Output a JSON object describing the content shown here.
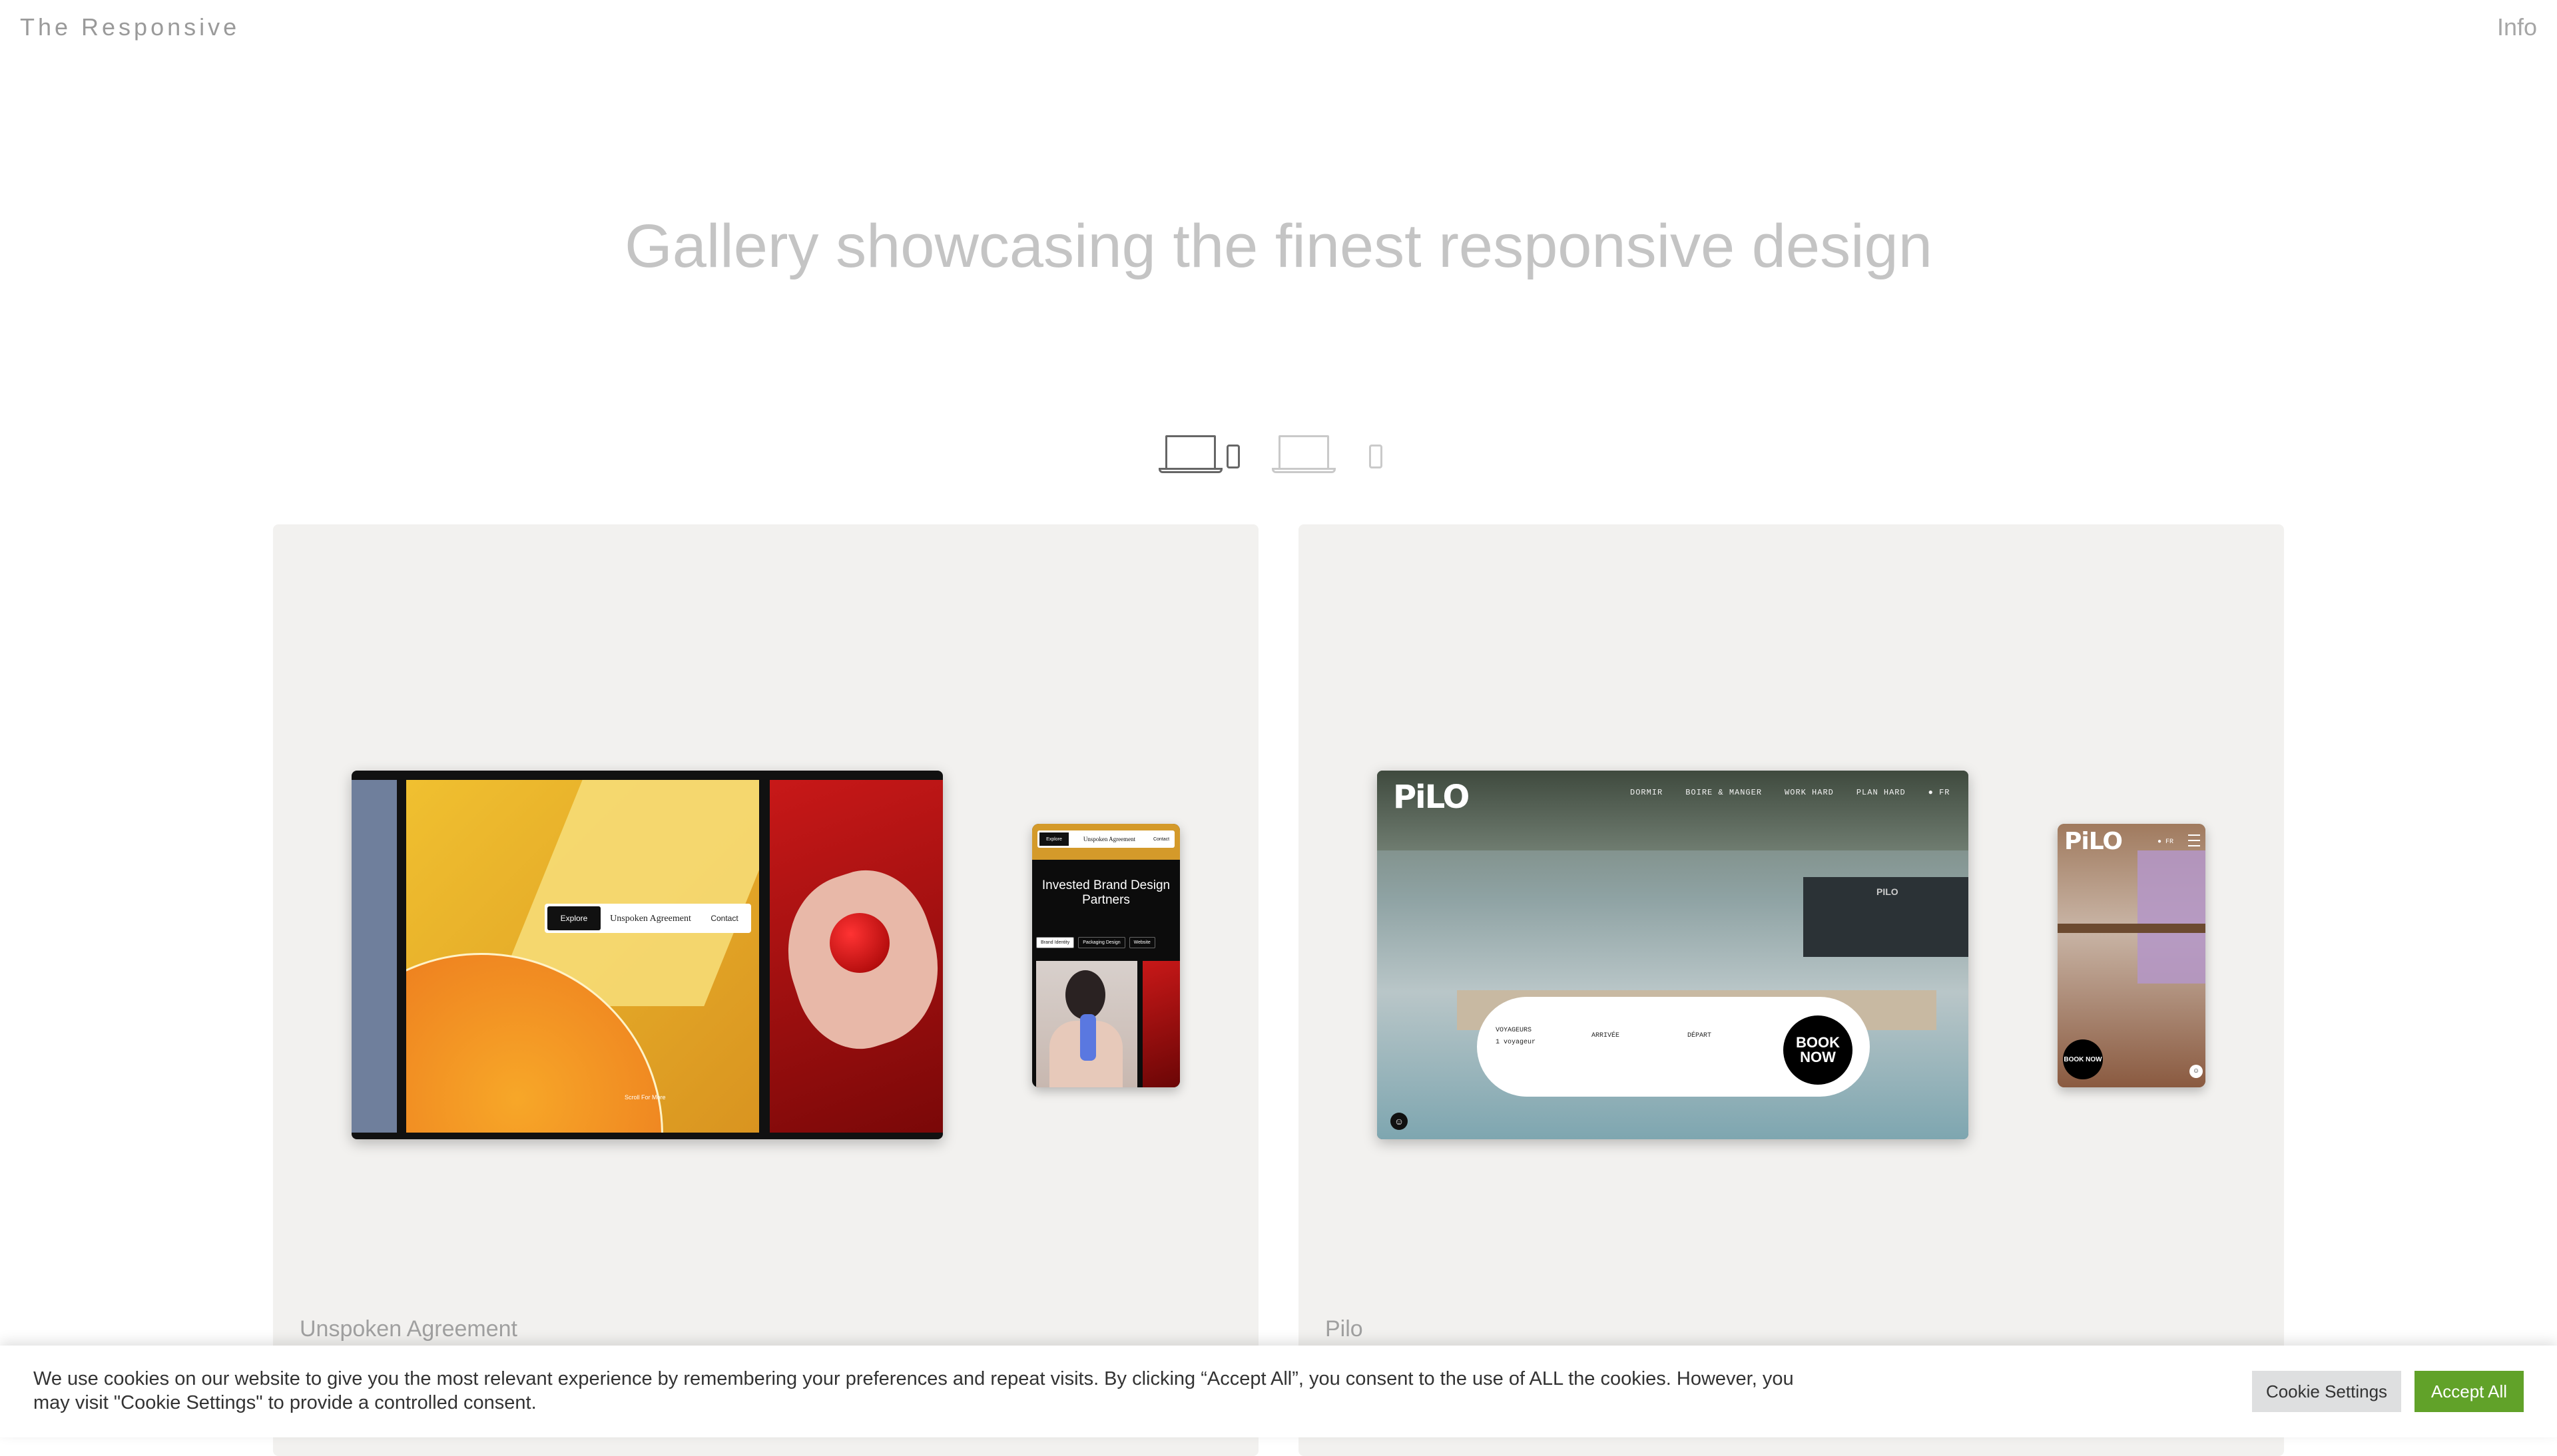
{
  "header": {
    "brand": "The Responsive",
    "info_link": "Info"
  },
  "hero": {
    "headline": "Gallery showcasing the finest responsive design"
  },
  "view_toggle": {
    "options": [
      "laptop-and-phone",
      "laptop-only",
      "phone-only"
    ],
    "selected": "laptop-and-phone"
  },
  "gallery": [
    {
      "title": "Unspoken Agreement",
      "desktop": {
        "nav_explore": "Explore",
        "logo": "Unspoken Agreement",
        "nav_contact": "Contact",
        "scroll_hint": "Scroll For More"
      },
      "mobile": {
        "nav_explore": "Explore",
        "logo": "Unspoken Agreement",
        "nav_contact": "Contact",
        "headline": "Invested Brand Design Partners",
        "pills": [
          "Brand Identity",
          "Packaging Design",
          "Website"
        ]
      }
    },
    {
      "title": "Pilo",
      "desktop": {
        "logo": "PiLO",
        "menu": [
          "DORMIR",
          "BOIRE & MANGER",
          "WORK HARD",
          "PLAN HARD",
          "● FR"
        ],
        "board_logo": "PILO",
        "field_voyageurs": "VOYAGEURS",
        "field_voyageurs_value": "1 voyageur",
        "field_arrivee": "ARRIVÉE",
        "field_depart": "DÉPART",
        "book_now": "BOOK NOW"
      },
      "mobile": {
        "logo": "PiLO",
        "lang": "● FR",
        "book_now": "BOOK NOW"
      }
    }
  ],
  "cookie_banner": {
    "text": "We use cookies on our website to give you the most relevant experience by remembering your preferences and repeat visits. By clicking “Accept All”, you consent to the use of ALL the cookies. However, you may visit \"Cookie Settings\" to provide a controlled consent.",
    "settings_label": "Cookie Settings",
    "accept_label": "Accept All"
  },
  "colors": {
    "accent_green": "#61a229",
    "card_bg": "#f2f1ef",
    "headline_grey": "#c4c4c4"
  }
}
